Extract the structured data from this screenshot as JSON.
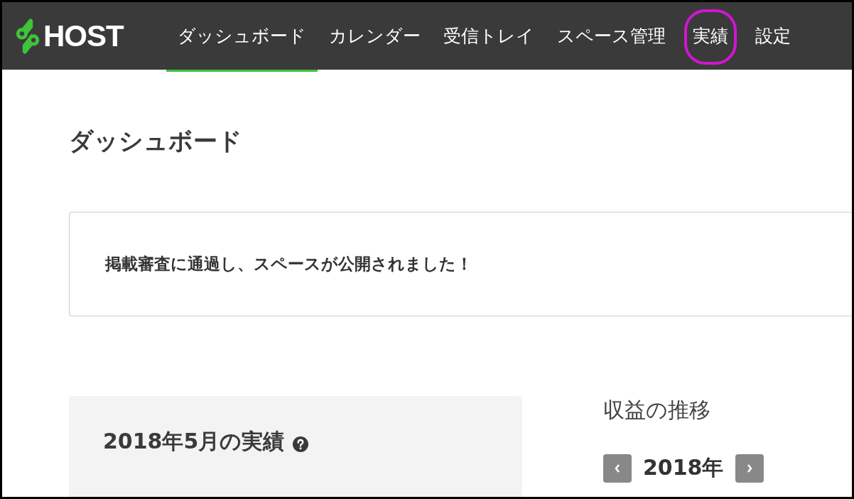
{
  "brand": {
    "name": "HOST"
  },
  "nav": [
    {
      "label": "ダッシュボード",
      "selected": true,
      "highlighted": false
    },
    {
      "label": "カレンダー",
      "selected": false,
      "highlighted": false
    },
    {
      "label": "受信トレイ",
      "selected": false,
      "highlighted": false
    },
    {
      "label": "スペース管理",
      "selected": false,
      "highlighted": false
    },
    {
      "label": "実績",
      "selected": false,
      "highlighted": true
    },
    {
      "label": "設定",
      "selected": false,
      "highlighted": false
    }
  ],
  "page_title": "ダッシュボード",
  "notice": "掲載審査に通過し、スペースが公開されました！",
  "summary_card": {
    "title": "2018年5月の実績"
  },
  "revenue": {
    "title": "収益の推移",
    "year": "2018年"
  }
}
